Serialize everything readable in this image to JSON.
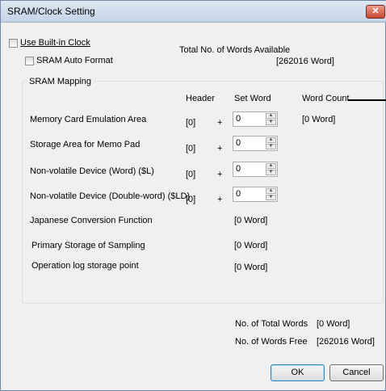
{
  "window": {
    "title": "SRAM/Clock Setting",
    "close_glyph": "✕"
  },
  "options": {
    "use_builtin_clock": "Use Built-in Clock",
    "sram_auto_format": "SRAM Auto Format"
  },
  "words_available": {
    "label": "Total No. of Words Available",
    "value": "[262016 Word]"
  },
  "mapping": {
    "group_label": "SRAM Mapping",
    "headers": {
      "header": "Header",
      "set_word": "Set Word",
      "word_count": "Word Count"
    },
    "rows": [
      {
        "label": "Memory Card Emulation Area",
        "header": "[0]",
        "plus": "+",
        "set_word": "0",
        "count": "[0 Word]"
      },
      {
        "label": "Storage Area for Memo Pad",
        "header": "[0]",
        "plus": "+",
        "set_word": "0"
      },
      {
        "label": "Non-volatile Device (Word) ($L)",
        "header": "[0]",
        "plus": "+",
        "set_word": "0"
      },
      {
        "label": "Non-volatile Device (Double-word) ($LD)",
        "header": "[0]",
        "plus": "+",
        "set_word": "0"
      }
    ],
    "extra_rows": [
      {
        "label": "Japanese Conversion Function",
        "count": "[0 Word]"
      },
      {
        "label": "Primary Storage of Sampling",
        "count": "[0 Word]"
      },
      {
        "label": "Operation log storage point",
        "count": "[0 Word]"
      }
    ]
  },
  "totals": {
    "total_label": "No. of Total Words",
    "total_value": "[0 Word]",
    "free_label": "No. of Words Free",
    "free_value": "[262016 Word]"
  },
  "buttons": {
    "ok": "OK",
    "cancel": "Cancel"
  },
  "icons": {
    "spin_up": "▲",
    "spin_down": "▼"
  }
}
